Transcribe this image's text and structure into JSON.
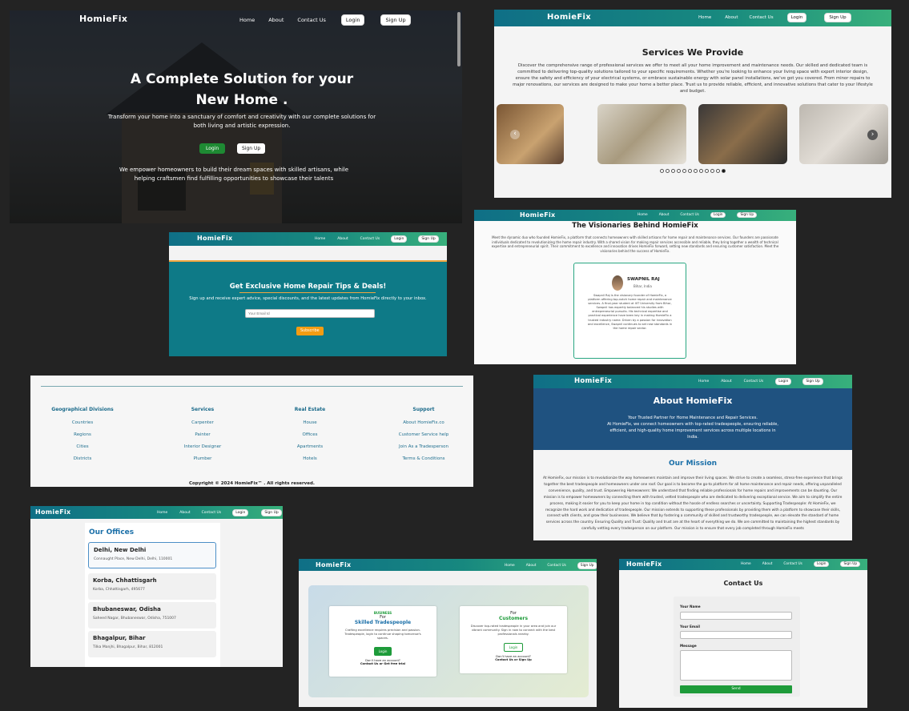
{
  "nav": {
    "brand": "HomieFix",
    "home": "Home",
    "about": "About",
    "contact": "Contact Us",
    "login": "Login",
    "signup": "Sign Up"
  },
  "hero": {
    "title_line1": "A Complete Solution for your",
    "title_line2": "New Home .",
    "subtitle": "Transform your home into a sanctuary of comfort and creativity with our complete solutions for both living and artistic expression.",
    "login": "Login",
    "signup": "Sign Up",
    "tagline": "We empower homeowners to build their dream spaces with skilled artisans, while helping craftsmen find fulfilling opportunities to showcase their talents"
  },
  "services": {
    "title": "Services We Provide",
    "desc": "Discover the comprehensive range of professional services we offer to meet all your home improvement and maintenance needs. Our skilled and dedicated team is committed to delivering top-quality solutions tailored to your specific requirements. Whether you're looking to enhance your living space with expert interior design, ensure the safety and efficiency of your electrical systems, or embrace sustainable energy with solar panel installations, we've got you covered. From minor repairs to major renovations, our services are designed to make your home a better place. Trust us to provide reliable, efficient, and innovative solutions that cater to your lifestyle and budget.",
    "prev": "‹",
    "next": "›"
  },
  "newsletter": {
    "title": "Get Exclusive Home Repair Tips & Deals!",
    "desc": "Sign up and receive expert advice, special discounts, and the latest updates from HomieFix directly to your inbox.",
    "placeholder": "Your Email Id",
    "button": "Subscribe"
  },
  "visionaries": {
    "title": "The Visionaries Behind HomieFix",
    "desc": "Meet the dynamic duo who founded HomieFix, a platform that connects homeowners with skilled artisans for home repair and maintenance services. Our founders are passionate individuals dedicated to revolutionizing the home repair industry. With a shared vision for making repair services accessible and reliable, they bring together a wealth of technical expertise and entrepreneurial spirit. Their commitment to excellence and innovation drives HomieFix forward, setting new standards and ensuring customer satisfaction. Meet the visionaries behind the success of HomieFix.",
    "name": "SWAPNIL RAJ",
    "location": "Bihar, India",
    "bio": "Swapnil Raj is the visionary founder of HomieFix, a platform offering top-notch home repair and maintenance services. A final-year student at IIIT University from Bihar, Swapnil has expertly balanced his studies with entrepreneurial pursuits. His technical expertise and practical experience have been key in making HomieFix a trusted industry name. Driven by a passion for innovation and excellence, Swapnil continues to set new standards in the home repair sector."
  },
  "footer": {
    "cols": [
      {
        "h": "Geographical Divisions",
        "items": [
          "Countries",
          "Regions",
          "Cities",
          "Districts"
        ]
      },
      {
        "h": "Services",
        "items": [
          "Carpenter",
          "Painter",
          "Interior Designer",
          "Plumber"
        ]
      },
      {
        "h": "Real Estate",
        "items": [
          "House",
          "Offices",
          "Apartments",
          "Hotels"
        ]
      },
      {
        "h": "Support",
        "items": [
          "About HomieFix.co",
          "Customer Service help",
          "Join As a Tradesperson",
          "Terms & Conditions"
        ]
      }
    ],
    "copyright": "Copyright © 2024 HomieFix™ . All rights reserved."
  },
  "about": {
    "title": "About HomieFix",
    "tag1": "Your Trusted Partner for Home Maintenance and Repair Services.",
    "tag2": "At HomieFix, we connect homeowners with top-rated tradespeople, ensuring reliable, efficient, and high-quality home improvement services across multiple locations in India.",
    "mission_title": "Our Mission",
    "mission": "At HomieFix, our mission is to revolutionize the way homeowners maintain and improve their living spaces. We strive to create a seamless, stress-free experience that brings together the best tradespeople and homeowners under one roof. Our goal is to become the go-to platform for all home maintenance and repair needs, offering unparalleled convenience, quality, and trust. Empowering Homeowners: We understand that finding reliable professionals for home repairs and improvements can be daunting. Our mission is to empower homeowners by connecting them with trusted, vetted tradespeople who are dedicated to delivering exceptional service. We aim to simplify the entire process, making it easier for you to keep your home in top condition without the hassle of endless searches or uncertainty. Supporting Tradespeople: At HomieFix, we recognize the hard work and dedication of tradespeople. Our mission extends to supporting these professionals by providing them with a platform to showcase their skills, connect with clients, and grow their businesses. We believe that by fostering a community of skilled and trustworthy tradespeople, we can elevate the standard of home services across the country. Ensuring Quality and Trust: Quality and trust are at the heart of everything we do. We are committed to maintaining the highest standards by carefully vetting every tradesperson on our platform. Our mission is to ensure that every job completed through HomieFix meets"
  },
  "offices": {
    "title": "Our Offices",
    "list": [
      {
        "city": "Delhi, New Delhi",
        "addr": "Connaught Place, New Delhi, Delhi, 110001"
      },
      {
        "city": "Korba, Chhattisgarh",
        "addr": "Korba, Chhattisgarh, 495677"
      },
      {
        "city": "Bhubaneswar, Odisha",
        "addr": "Saheed Nagar, Bhubaneswar, Odisha, 751007"
      },
      {
        "city": "Bhagalpur, Bihar",
        "addr": "Tilka Manjhi, Bhagalpur, Bihar, 812001"
      }
    ]
  },
  "portal": {
    "biz_small": "BUSINESS",
    "for": "For",
    "biz_title": "Skilled Tradespeople",
    "biz_desc": "Crafting excellence requires precision and passion. Tradespeople, login to continue shaping tomorrow's spaces.",
    "cust_title": "Customers",
    "cust_desc": "Discover top-rated tradespeople in your area and join our vibrant community. Sign in now to connect with the best professionals nearby.",
    "login": "Login",
    "no_acc": "Don't have an account?",
    "biz_links": "Contact Us or Get free trial",
    "cust_links": "Contact Us or Sign Up"
  },
  "contact": {
    "title": "Contact Us",
    "name": "Your Name",
    "email": "Your Email",
    "message": "Message",
    "send": "Send"
  },
  "colors": {
    "brand": "#0f6f86",
    "accent": "#38b07c",
    "orange": "#f39c12",
    "green_btn": "#1e9b3a"
  }
}
